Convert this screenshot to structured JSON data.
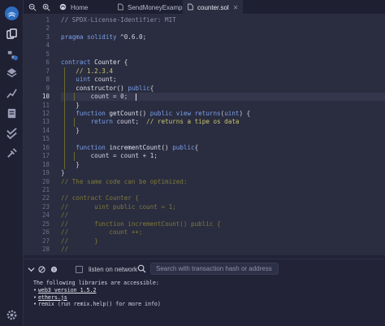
{
  "tabs": {
    "home_label": "Home",
    "items": [
      {
        "label": "SendMoneyExample.sol"
      },
      {
        "label": "counter.sol",
        "active": true
      }
    ]
  },
  "editor": {
    "current_line": 10,
    "line_numbers": [
      "1",
      "2",
      "3",
      "4",
      "5",
      "6",
      "7",
      "8",
      "9",
      "10",
      "11",
      "12",
      "13",
      "14",
      "15",
      "16",
      "17",
      "18",
      "19",
      "20",
      "21",
      "22",
      "23",
      "24",
      "25",
      "26",
      "27",
      "28"
    ],
    "lines": [
      [
        {
          "c": "c-com",
          "t": "// SPDX-License-Identifier: MIT"
        }
      ],
      [],
      [
        {
          "c": "c-prag",
          "t": "pragma solidity "
        },
        {
          "c": "c-pl",
          "t": "^0.6.0;"
        }
      ],
      [],
      [],
      [
        {
          "c": "c-kw",
          "t": "contract "
        },
        {
          "c": "c-fn",
          "t": "Counter {"
        }
      ],
      [
        {
          "c": "c-pl",
          "t": "    "
        },
        {
          "c": "c-gcom",
          "t": "// 1.2.3.4"
        }
      ],
      [
        {
          "c": "c-pl",
          "t": "    "
        },
        {
          "c": "c-kw",
          "t": "uint "
        },
        {
          "c": "c-pl",
          "t": "count;"
        }
      ],
      [
        {
          "c": "c-pl",
          "t": "    "
        },
        {
          "c": "c-fn",
          "t": "constructor() "
        },
        {
          "c": "c-kw",
          "t": "public"
        },
        {
          "c": "c-pl",
          "t": "{"
        }
      ],
      [
        {
          "c": "c-pl",
          "t": "        count = 0;"
        }
      ],
      [
        {
          "c": "c-pl",
          "t": "    }"
        }
      ],
      [
        {
          "c": "c-pl",
          "t": "    "
        },
        {
          "c": "c-kw",
          "t": "function "
        },
        {
          "c": "c-fn",
          "t": "getCount() "
        },
        {
          "c": "c-kw",
          "t": "public view returns"
        },
        {
          "c": "c-pl",
          "t": "("
        },
        {
          "c": "c-kw",
          "t": "uint"
        },
        {
          "c": "c-pl",
          "t": ") {"
        }
      ],
      [
        {
          "c": "c-pl",
          "t": "        "
        },
        {
          "c": "c-kw",
          "t": "return "
        },
        {
          "c": "c-pl",
          "t": "count;  "
        },
        {
          "c": "c-gcom",
          "t": "// returns a tipe os data"
        }
      ],
      [
        {
          "c": "c-pl",
          "t": "    }"
        }
      ],
      [],
      [
        {
          "c": "c-pl",
          "t": "    "
        },
        {
          "c": "c-kw",
          "t": "function "
        },
        {
          "c": "c-fn",
          "t": "incrementCount() "
        },
        {
          "c": "c-kw",
          "t": "public"
        },
        {
          "c": "c-pl",
          "t": "{"
        }
      ],
      [
        {
          "c": "c-pl",
          "t": "        count = count + 1;"
        }
      ],
      [
        {
          "c": "c-pl",
          "t": "    }"
        }
      ],
      [
        {
          "c": "c-pl",
          "t": "}"
        }
      ],
      [
        {
          "c": "c-ccom",
          "t": "// The same code can be optimized:"
        }
      ],
      [],
      [
        {
          "c": "c-ccom",
          "t": "// contract Counter {"
        }
      ],
      [
        {
          "c": "c-ccom",
          "t": "//       uint public count = 1;"
        }
      ],
      [
        {
          "c": "c-ccom",
          "t": "//"
        }
      ],
      [
        {
          "c": "c-ccom",
          "t": "//       function incrementCount() public {"
        }
      ],
      [
        {
          "c": "c-ccom",
          "t": "//           count ++;"
        }
      ],
      [
        {
          "c": "c-ccom",
          "t": "//       }"
        }
      ],
      [
        {
          "c": "c-ccom",
          "t": "//"
        }
      ]
    ]
  },
  "terminal": {
    "listen_label": "listen on network",
    "search_placeholder": "Search with transaction hash or address",
    "intro": "The following libraries are accessible:",
    "libs": [
      {
        "text": "web3 version 1.5.2",
        "link": true
      },
      {
        "text": "ethers.js",
        "link": true
      },
      {
        "text": "remix (run remix.help() for more info)",
        "link": false
      }
    ]
  },
  "icons": {
    "rail": [
      "remix-logo-icon",
      "file-explorer-icon",
      "plugin-manager-icon",
      "solidity-compiler-icon",
      "deploy-run-icon",
      "analysis-icon",
      "docs-icon",
      "unit-test-icon",
      "debugger-icon",
      "settings-icon"
    ],
    "tabbar": [
      "zoom-out-icon",
      "zoom-in-icon",
      "home-icon",
      "file-icon",
      "file-icon"
    ]
  },
  "colors": {
    "background": "#222336",
    "editor_bg": "#2a2c3f",
    "keyword": "#7aa0e8",
    "comment": "#8b8fa8"
  }
}
